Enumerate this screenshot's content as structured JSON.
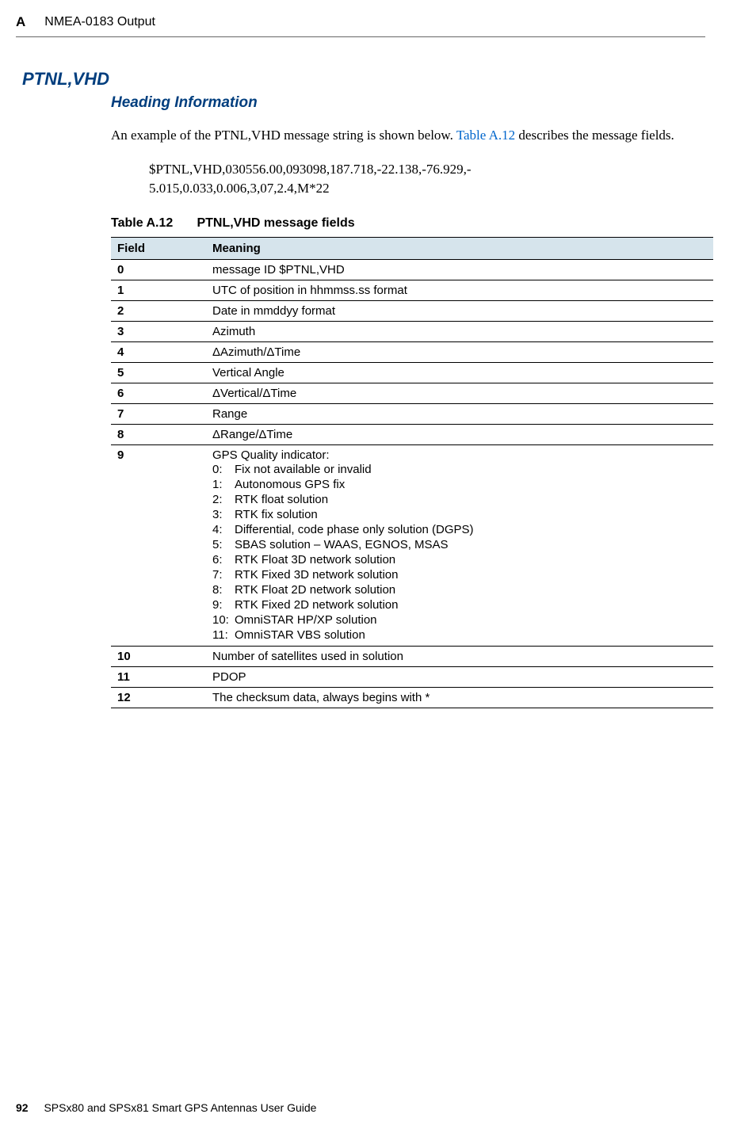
{
  "header": {
    "appendix": "A",
    "title": "NMEA-0183 Output"
  },
  "section": {
    "title": "PTNL,VHD",
    "subtitle": "Heading Information",
    "intro_before_link": "An example of the PTNL,VHD message string is shown below. ",
    "link_text": "Table A.12",
    "intro_after_link": " describes the message fields.",
    "example_line1": "$PTNL,VHD,030556.00,093098,187.718,-22.138,-76.929,-",
    "example_line2": "5.015,0.033,0.006,3,07,2.4,M*22"
  },
  "table": {
    "caption_label": "Table A.12",
    "caption_text": "PTNL,VHD message fields",
    "header_field": "Field",
    "header_meaning": "Meaning",
    "rows": [
      {
        "field": "0",
        "meaning": "message ID $PTNL,VHD"
      },
      {
        "field": "1",
        "meaning": "UTC of position in hhmmss.ss format"
      },
      {
        "field": "2",
        "meaning": "Date in mmddyy format"
      },
      {
        "field": "3",
        "meaning": "Azimuth"
      },
      {
        "field": "4",
        "meaning": "ΔAzimuth/ΔTime"
      },
      {
        "field": "5",
        "meaning": "Vertical Angle"
      },
      {
        "field": "6",
        "meaning": "ΔVertical/ΔTime"
      },
      {
        "field": "7",
        "meaning": "Range"
      },
      {
        "field": "8",
        "meaning": "ΔRange/ΔTime"
      }
    ],
    "row9": {
      "field": "9",
      "heading": "GPS Quality indicator:",
      "items": [
        {
          "num": "0:",
          "text": "Fix not available or invalid"
        },
        {
          "num": "1:",
          "text": "Autonomous GPS fix"
        },
        {
          "num": "2:",
          "text": "RTK float solution"
        },
        {
          "num": "3:",
          "text": "RTK fix solution"
        },
        {
          "num": "4:",
          "text": "Differential, code phase only solution (DGPS)"
        },
        {
          "num": "5:",
          "text": "SBAS solution – WAAS, EGNOS, MSAS"
        },
        {
          "num": "6:",
          "text": "RTK Float 3D network solution"
        },
        {
          "num": "7:",
          "text": "RTK Fixed 3D network solution"
        },
        {
          "num": "8:",
          "text": "RTK Float 2D network solution"
        },
        {
          "num": "9:",
          "text": "RTK Fixed 2D network solution"
        },
        {
          "num": "10:",
          "text": "OmniSTAR HP/XP solution"
        },
        {
          "num": "11:",
          "text": "OmniSTAR VBS solution"
        }
      ]
    },
    "rows_after": [
      {
        "field": "10",
        "meaning": "Number of satellites used in solution"
      },
      {
        "field": "11",
        "meaning": "PDOP"
      },
      {
        "field": "12",
        "meaning": "The checksum data, always begins with *"
      }
    ]
  },
  "footer": {
    "page": "92",
    "title": "SPSx80 and SPSx81 Smart GPS Antennas User Guide"
  }
}
